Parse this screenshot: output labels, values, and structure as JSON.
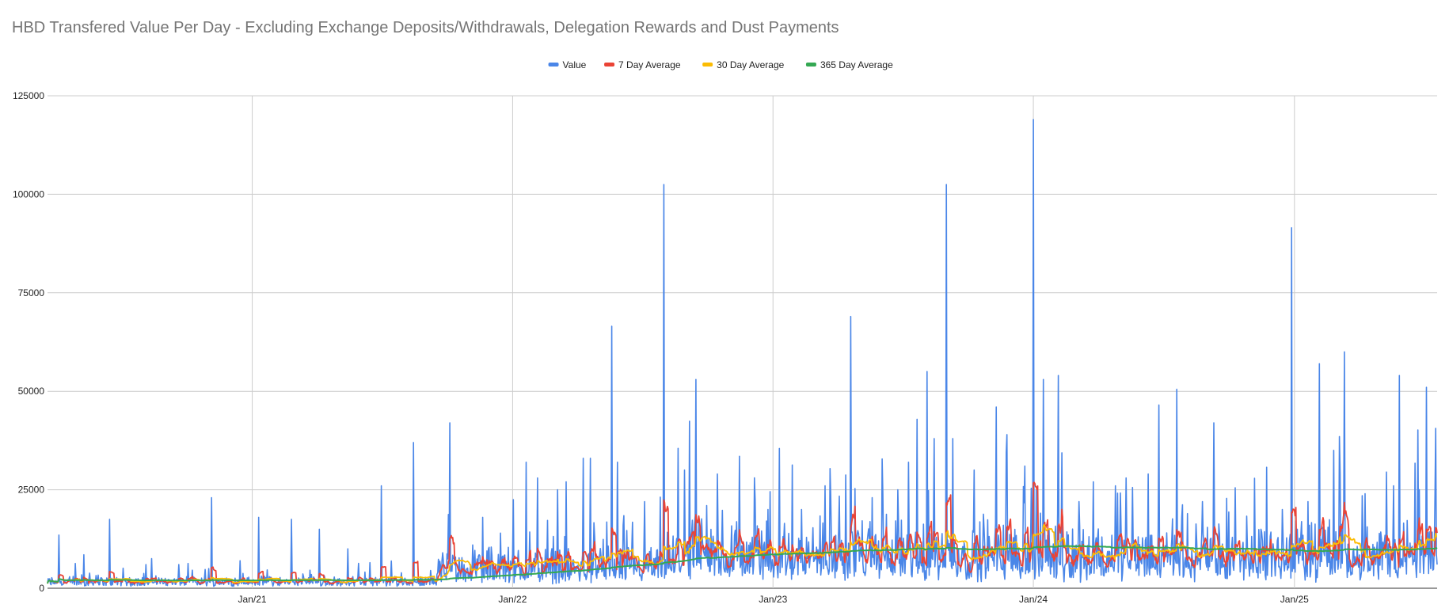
{
  "chart_data": {
    "type": "line",
    "title": "HBD Transfered Value Per Day - Excluding Exchange Deposits/Withdrawals, Delegation Rewards and Dust Payments",
    "xlabel": "",
    "ylabel": "",
    "ylim": [
      0,
      125000
    ],
    "xlim": [
      "2020-03-20",
      "2025-07-20"
    ],
    "y_ticks": [
      0,
      25000,
      50000,
      75000,
      100000,
      125000
    ],
    "x_ticks": [
      {
        "label": "Jan/21",
        "date": "2021-01-01"
      },
      {
        "label": "Jan/22",
        "date": "2022-01-01"
      },
      {
        "label": "Jan/23",
        "date": "2023-01-01"
      },
      {
        "label": "Jan/24",
        "date": "2024-01-01"
      },
      {
        "label": "Jan/25",
        "date": "2025-01-01"
      }
    ],
    "grid": true,
    "legend_position": "top",
    "series": [
      {
        "name": "Value",
        "color": "#4a86e8",
        "points": [
          [
            "2020-03-20",
            1200
          ],
          [
            "2020-04-05",
            13500
          ],
          [
            "2020-04-25",
            3000
          ],
          [
            "2020-05-10",
            8500
          ],
          [
            "2020-05-25",
            2000
          ],
          [
            "2020-06-15",
            17500
          ],
          [
            "2020-07-10",
            1500
          ],
          [
            "2020-08-05",
            6000
          ],
          [
            "2020-09-01",
            2500
          ],
          [
            "2020-09-20",
            6000
          ],
          [
            "2020-10-10",
            1500
          ],
          [
            "2020-11-05",
            23000
          ],
          [
            "2020-11-25",
            1500
          ],
          [
            "2020-12-15",
            7000
          ],
          [
            "2020-12-28",
            1200
          ],
          [
            "2021-01-10",
            18000
          ],
          [
            "2021-02-01",
            2000
          ],
          [
            "2021-02-25",
            17500
          ],
          [
            "2021-03-20",
            1500
          ],
          [
            "2021-04-05",
            15000
          ],
          [
            "2021-04-25",
            1800
          ],
          [
            "2021-05-15",
            10000
          ],
          [
            "2021-06-01",
            2000
          ],
          [
            "2021-06-15",
            6500
          ],
          [
            "2021-07-01",
            26000
          ],
          [
            "2021-07-20",
            3000
          ],
          [
            "2021-08-15",
            37000
          ],
          [
            "2021-09-05",
            2500
          ],
          [
            "2021-09-25",
            9000
          ],
          [
            "2021-10-20",
            2500
          ],
          [
            "2021-11-15",
            8500
          ],
          [
            "2021-12-10",
            3000
          ],
          [
            "2021-12-25",
            5000
          ],
          [
            "2021-08-10",
            2000
          ],
          [
            "2021-09-30",
            2200
          ],
          [
            "2021-10-05",
            42000
          ],
          [
            "2021-10-25",
            6000
          ],
          [
            "2021-11-20",
            18000
          ],
          [
            "2021-12-15",
            14000
          ],
          [
            "2022-01-05",
            3000
          ],
          [
            "2022-01-20",
            32000
          ],
          [
            "2022-02-05",
            28000
          ],
          [
            "2022-02-20",
            4000
          ],
          [
            "2022-03-05",
            25000
          ],
          [
            "2022-03-25",
            5000
          ],
          [
            "2022-04-10",
            33000
          ],
          [
            "2022-04-20",
            33000
          ],
          [
            "2022-05-05",
            8000
          ],
          [
            "2022-05-20",
            66500
          ],
          [
            "2022-05-28",
            32000
          ],
          [
            "2022-06-15",
            6000
          ],
          [
            "2022-07-05",
            22000
          ],
          [
            "2022-07-25",
            8000
          ],
          [
            "2022-08-01",
            102500
          ],
          [
            "2022-08-15",
            4000
          ],
          [
            "2022-08-30",
            30000
          ],
          [
            "2022-09-15",
            53000
          ],
          [
            "2022-09-25",
            10000
          ],
          [
            "2022-10-15",
            29000
          ],
          [
            "2022-11-01",
            3000
          ],
          [
            "2022-11-15",
            33500
          ],
          [
            "2022-12-05",
            6000
          ],
          [
            "2022-12-25",
            20000
          ],
          [
            "2023-01-10",
            35500
          ],
          [
            "2023-01-25",
            5000
          ],
          [
            "2023-02-10",
            20000
          ],
          [
            "2023-03-01",
            8000
          ],
          [
            "2023-03-15",
            26000
          ],
          [
            "2023-04-01",
            5000
          ],
          [
            "2023-04-20",
            69000
          ],
          [
            "2023-05-05",
            8000
          ],
          [
            "2023-05-20",
            23000
          ],
          [
            "2023-06-10",
            5000
          ],
          [
            "2023-06-25",
            25000
          ],
          [
            "2023-07-10",
            32000
          ],
          [
            "2023-07-25",
            5000
          ],
          [
            "2023-08-05",
            55000
          ],
          [
            "2023-08-15",
            38000
          ],
          [
            "2023-08-25",
            10000
          ],
          [
            "2023-09-01",
            102500
          ],
          [
            "2023-09-10",
            38000
          ],
          [
            "2023-09-25",
            8000
          ],
          [
            "2023-10-10",
            30000
          ],
          [
            "2023-10-25",
            10000
          ],
          [
            "2023-11-10",
            46000
          ],
          [
            "2023-11-25",
            39000
          ],
          [
            "2023-12-05",
            6000
          ],
          [
            "2023-12-20",
            31000
          ],
          [
            "2024-01-01",
            119000
          ],
          [
            "2024-01-10",
            10000
          ],
          [
            "2024-01-15",
            53000
          ],
          [
            "2024-01-28",
            8000
          ],
          [
            "2024-02-05",
            54000
          ],
          [
            "2024-02-20",
            6000
          ],
          [
            "2024-03-05",
            22000
          ],
          [
            "2024-03-25",
            27000
          ],
          [
            "2024-04-10",
            5000
          ],
          [
            "2024-04-25",
            26000
          ],
          [
            "2024-05-10",
            28000
          ],
          [
            "2024-05-25",
            6000
          ],
          [
            "2024-06-10",
            29000
          ],
          [
            "2024-06-25",
            46500
          ],
          [
            "2024-07-05",
            8000
          ],
          [
            "2024-07-20",
            50500
          ],
          [
            "2024-08-05",
            5000
          ],
          [
            "2024-08-25",
            22000
          ],
          [
            "2024-09-10",
            42000
          ],
          [
            "2024-09-25",
            6000
          ],
          [
            "2024-10-10",
            25500
          ],
          [
            "2024-10-25",
            5000
          ],
          [
            "2024-11-15",
            15000
          ],
          [
            "2024-12-01",
            8000
          ],
          [
            "2024-12-15",
            20000
          ],
          [
            "2024-12-28",
            91500
          ],
          [
            "2025-01-05",
            15000
          ],
          [
            "2025-01-20",
            22000
          ],
          [
            "2025-02-05",
            57000
          ],
          [
            "2025-02-15",
            8000
          ],
          [
            "2025-02-25",
            35000
          ],
          [
            "2025-03-05",
            38500
          ],
          [
            "2025-03-12",
            60000
          ],
          [
            "2025-03-25",
            10000
          ],
          [
            "2025-04-10",
            24000
          ],
          [
            "2025-04-25",
            6000
          ],
          [
            "2025-05-10",
            29500
          ],
          [
            "2025-05-20",
            26000
          ],
          [
            "2025-05-28",
            54000
          ],
          [
            "2025-06-10",
            8000
          ],
          [
            "2025-06-25",
            25000
          ],
          [
            "2025-07-05",
            51000
          ],
          [
            "2025-07-20",
            6000
          ]
        ]
      },
      {
        "name": "7 Day Average",
        "color": "#ea4335",
        "points": []
      },
      {
        "name": "30 Day Average",
        "color": "#fbbc04",
        "points": []
      },
      {
        "name": "365 Day Average",
        "color": "#34a853",
        "points": []
      }
    ]
  }
}
